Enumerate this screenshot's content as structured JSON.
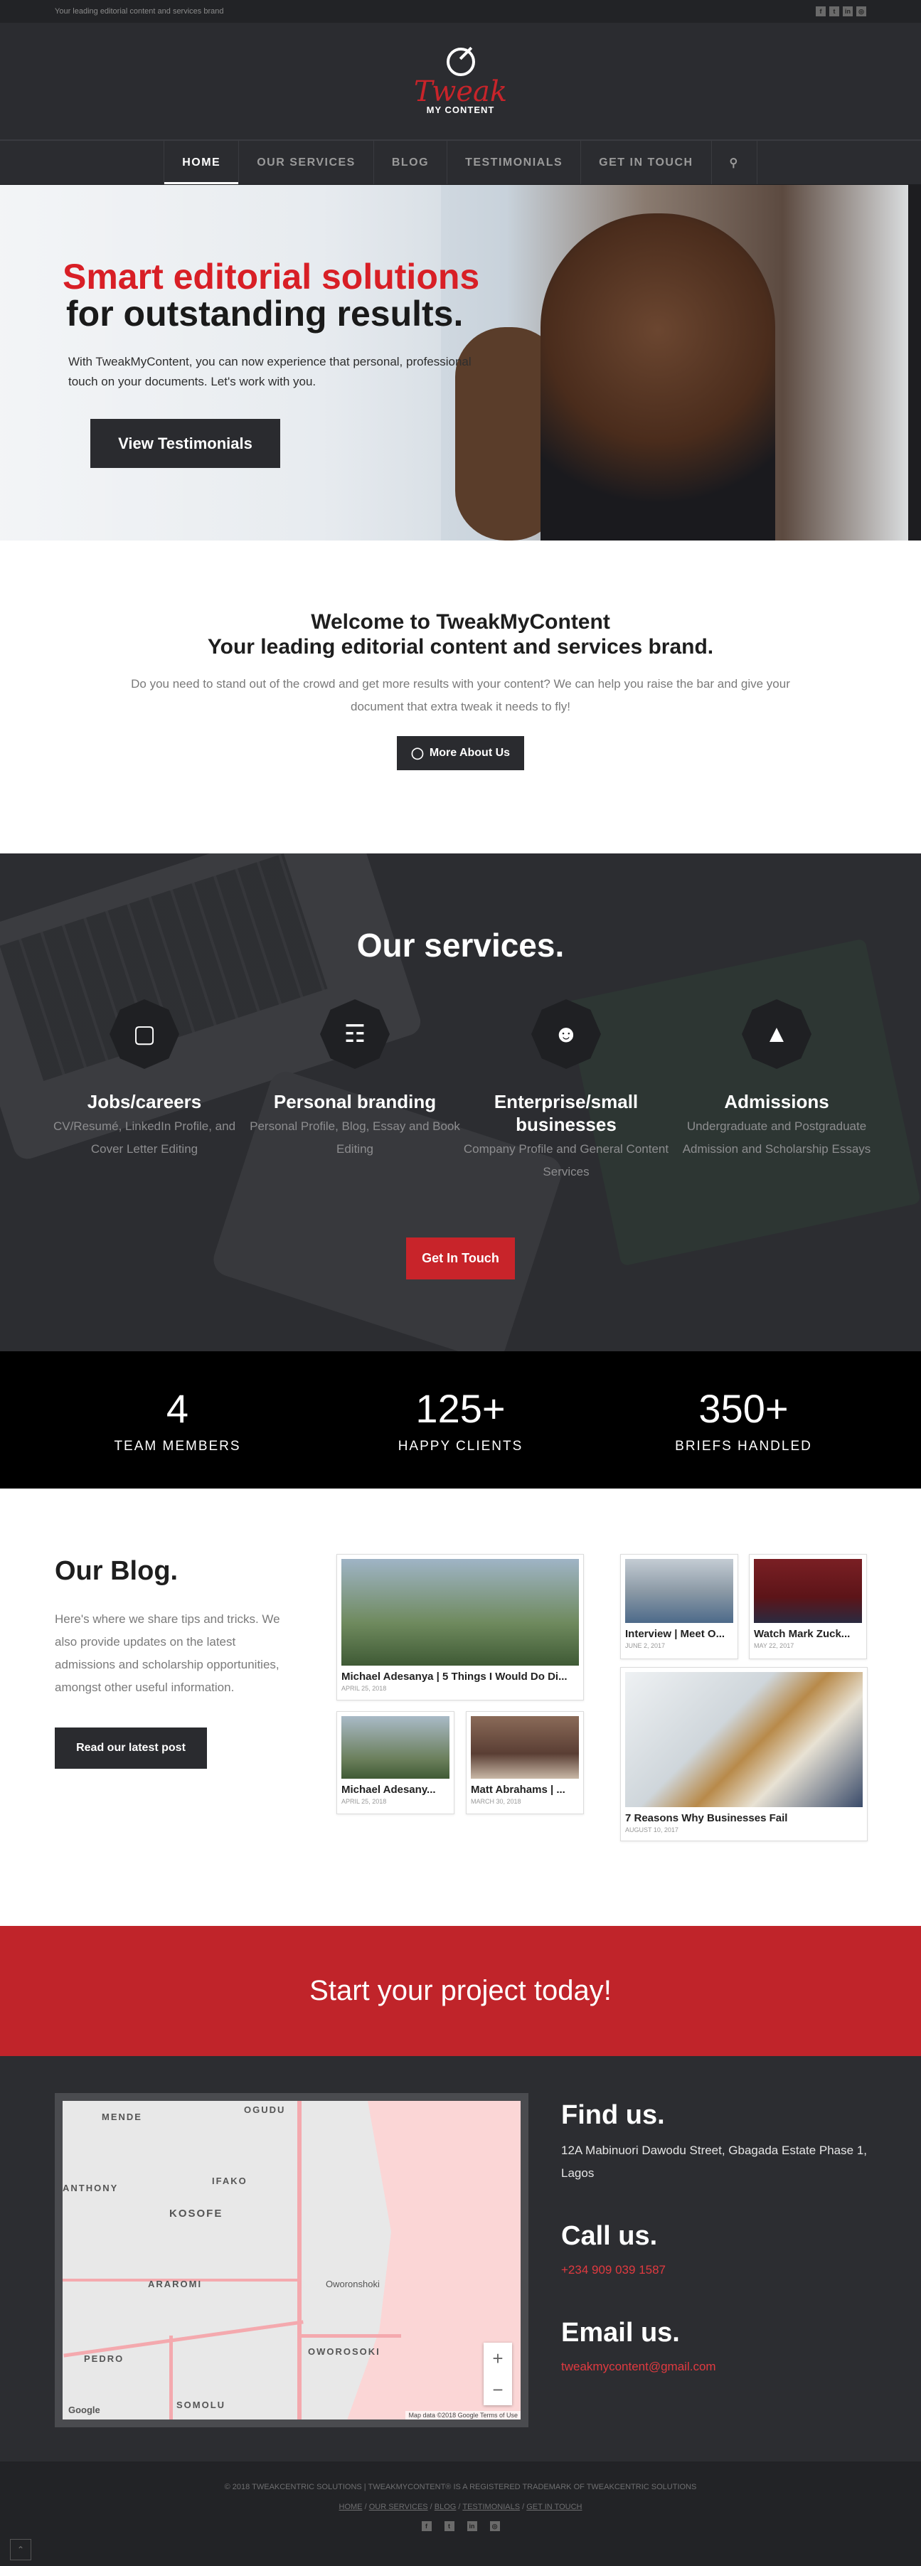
{
  "topbar": {
    "tagline": "Your leading editorial content and services brand"
  },
  "logo": {
    "word": "Tweak",
    "sub": "MY CONTENT"
  },
  "nav": {
    "items": [
      "HOME",
      "OUR SERVICES",
      "BLOG",
      "TESTIMONIALS",
      "GET IN TOUCH"
    ]
  },
  "hero": {
    "line1": "Smart editorial solutions",
    "line2": "for outstanding results.",
    "text": "With TweakMyContent, you can now experience that personal, professional touch on your documents. Let's work with you.",
    "button": "View Testimonials"
  },
  "welcome": {
    "title1": "Welcome to TweakMyContent",
    "title2": "Your leading editorial content and services brand.",
    "text": "Do you need to stand out of the crowd and get more results with your content? We can help you raise the bar and give your document that extra tweak it needs to fly!",
    "button": "More About Us"
  },
  "services": {
    "title": "Our services.",
    "items": [
      {
        "title": "Jobs/careers",
        "text": "CV/Resumé, LinkedIn Profile, and Cover Letter Editing",
        "icon": "briefcase-icon"
      },
      {
        "title": "Personal branding",
        "text": "Personal Profile, Blog, Essay and Book Editing",
        "icon": "book-icon"
      },
      {
        "title": "Enterprise/small businesses",
        "text": "Company Profile and General Content Services",
        "icon": "users-icon"
      },
      {
        "title": "Admissions",
        "text": "Undergraduate and Postgraduate Admission and Scholarship Essays",
        "icon": "graduation-cap-icon"
      }
    ],
    "button": "Get In Touch"
  },
  "stats": [
    {
      "num": "4",
      "label": "TEAM MEMBERS"
    },
    {
      "num": "125+",
      "label": "HAPPY CLIENTS"
    },
    {
      "num": "350+",
      "label": "BRIEFS HANDLED"
    }
  ],
  "blog": {
    "title": "Our Blog.",
    "text": "Here's where we share tips and tricks. We also provide updates on the latest admissions and scholarship opportunities, amongst other useful information.",
    "button": "Read our latest post",
    "posts": [
      {
        "title": "Michael Adesanya | 5 Things I Would Do Di...",
        "date": "APRIL 25, 2018"
      },
      {
        "title": "Michael Adesany...",
        "date": "APRIL 25, 2018"
      },
      {
        "title": "Matt Abrahams | ...",
        "date": "MARCH 30, 2018"
      },
      {
        "title": "Interview | Meet O...",
        "date": "JUNE 2, 2017"
      },
      {
        "title": "Watch Mark Zuck...",
        "date": "MAY 22, 2017"
      },
      {
        "title": "7 Reasons Why Businesses Fail",
        "date": "AUGUST 10, 2017"
      }
    ]
  },
  "cta": {
    "title": "Start your project today!"
  },
  "contact": {
    "find_title": "Find us.",
    "address": "12A Mabinuori Dawodu Street, Gbagada Estate Phase 1, Lagos",
    "call_title": "Call us.",
    "phone": "+234 909 039 1587",
    "email_title": "Email us.",
    "email": "tweakmycontent@gmail.com",
    "map_labels": [
      "MENDE",
      "OGUDU",
      "ANTHONY",
      "IFAKO",
      "KOSOFE",
      "ARAROMI",
      "Oworonshoki",
      "OWOROSOKI",
      "PEDRO",
      "SOMOLU"
    ],
    "map_credit": "Map data ©2018 Google   Terms of Use",
    "google": "Google"
  },
  "footer": {
    "copy": "© 2018 TWEAKCENTRIC SOLUTIONS | TWEAKMYCONTENT® IS A REGISTERED TRADEMARK OF TWEAKCENTRIC SOLUTIONS",
    "links": [
      "HOME",
      "OUR SERVICES",
      "BLOG",
      "TESTIMONIALS",
      "GET IN TOUCH"
    ]
  },
  "colors": {
    "brand_red": "#c8242a",
    "dark": "#2c2d31",
    "black": "#000000"
  }
}
